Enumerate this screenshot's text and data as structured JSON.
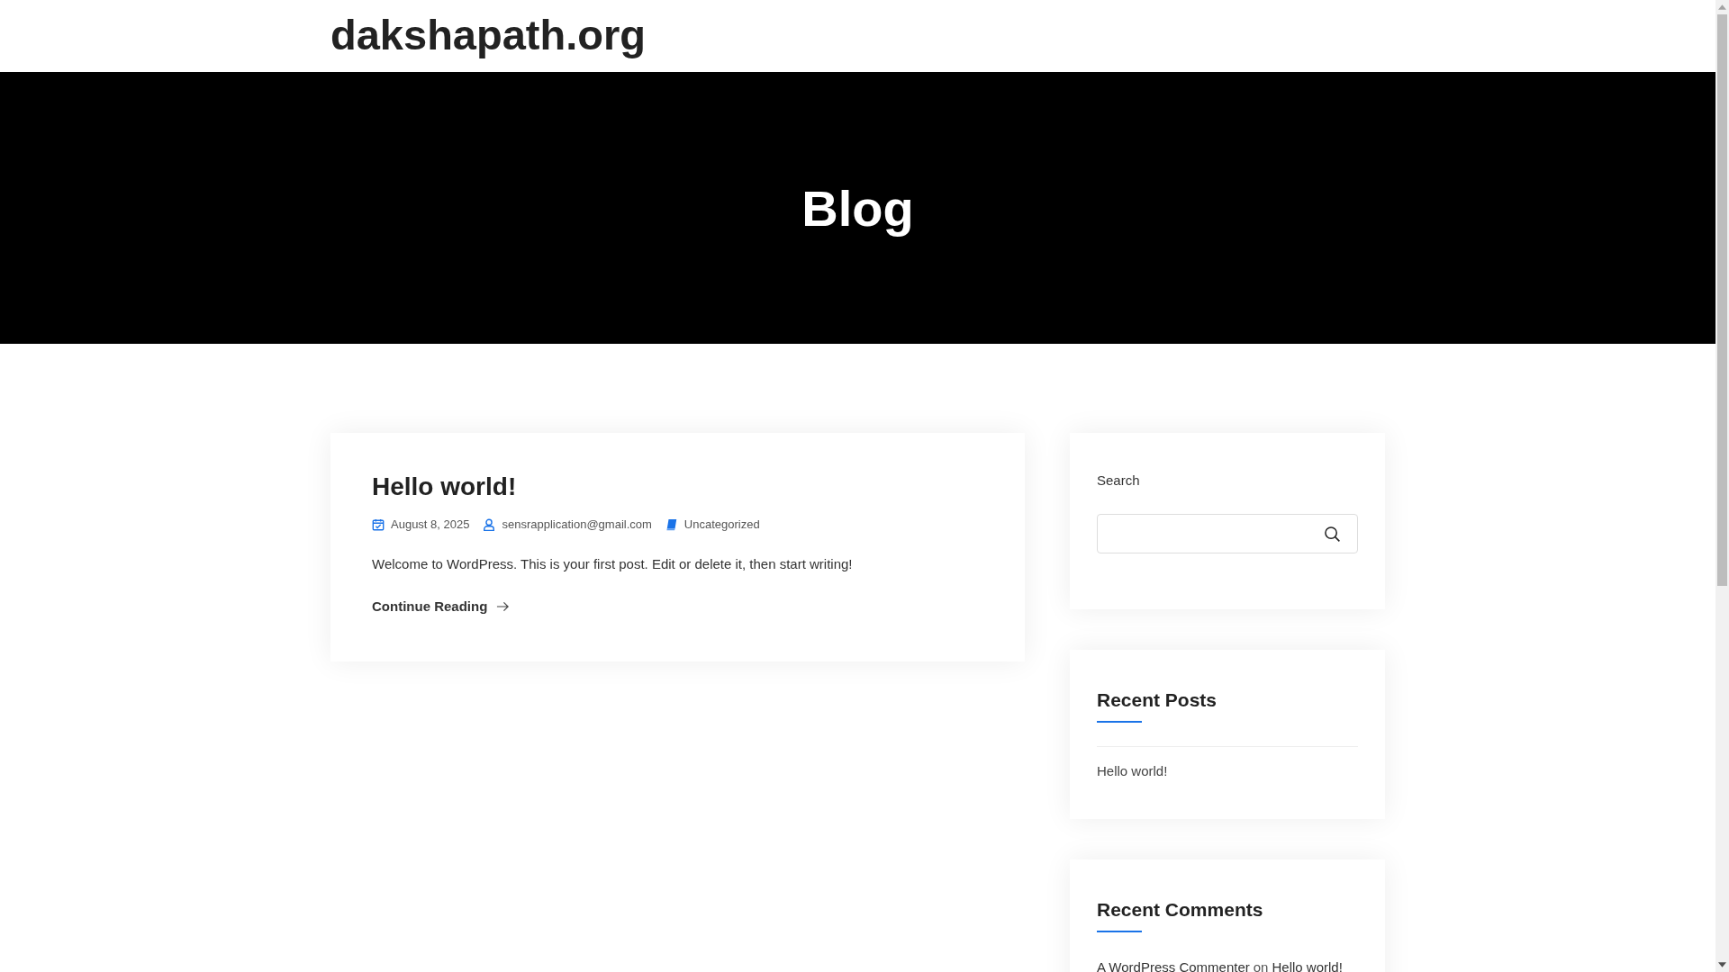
{
  "header": {
    "site_title": "dakshapath.org"
  },
  "hero": {
    "title": "Blog"
  },
  "posts": [
    {
      "title": "Hello world!",
      "date": "August 8, 2025",
      "author": "sensrapplication@gmail.com",
      "category": "Uncategorized",
      "excerpt": "Welcome to WordPress. This is your first post. Edit or delete it, then start writing!",
      "read_more": "Continue Reading"
    }
  ],
  "sidebar": {
    "search": {
      "label": "Search"
    },
    "recent_posts": {
      "title": "Recent Posts",
      "items": [
        "Hello world!"
      ]
    },
    "recent_comments": {
      "title": "Recent Comments",
      "items": [
        {
          "author": "A WordPress Commenter",
          "connector": "on",
          "post": "Hello world!"
        }
      ]
    }
  }
}
